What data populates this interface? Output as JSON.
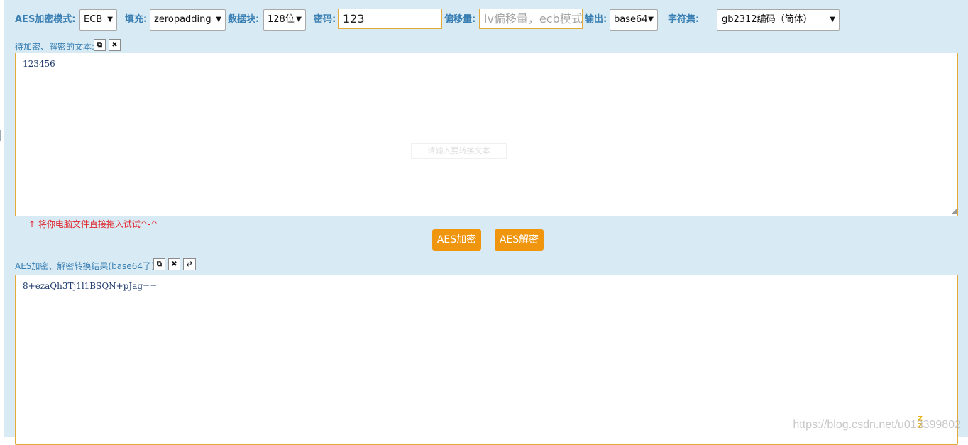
{
  "toolbar": {
    "mode_label": "AES加密模式:",
    "mode_value": "ECB",
    "padding_label": "填充:",
    "padding_value": "zeropadding",
    "block_label": "数据块:",
    "block_value": "128位",
    "password_label": "密码:",
    "password_value": "123",
    "iv_label": "偏移量:",
    "iv_placeholder": "iv偏移量，ecb模式",
    "output_label": "输出:",
    "output_value": "base64",
    "charset_label": "字符集:",
    "charset_value": "gb2312编码（简体）"
  },
  "input_section": {
    "label": "待加密、解密的文本:",
    "text": "123456",
    "placeholder": "请输入要转换文本",
    "drag_tip": "↑ 将你电脑文件直接拖入试试^-^"
  },
  "actions": {
    "encrypt_label": "AES加密",
    "decrypt_label": "AES解密"
  },
  "output_section": {
    "label": "AES加密、解密转换结果(base64了):",
    "text": "8+ezaQh3Tj1l1BSQN+pJag=="
  },
  "watermark": "https://blog.csdn.net/u013399802",
  "icons": {
    "copy": "⧉",
    "clear": "✖",
    "swap": "⇄",
    "dropdown": "▼"
  }
}
